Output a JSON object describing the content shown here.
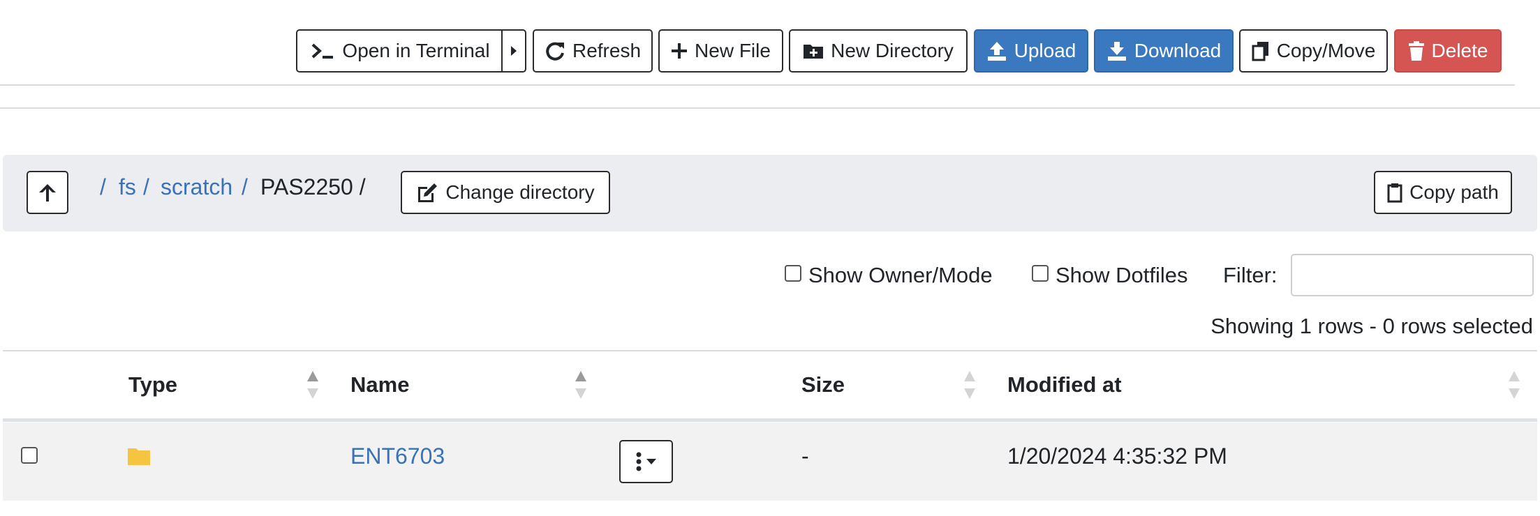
{
  "toolbar": {
    "open_terminal_label": "Open in Terminal",
    "refresh_label": "Refresh",
    "new_file_label": "New File",
    "new_directory_label": "New Directory",
    "upload_label": "Upload",
    "download_label": "Download",
    "copy_move_label": "Copy/Move",
    "delete_label": "Delete"
  },
  "path": {
    "root_sep": "/",
    "crumbs": [
      {
        "label": "fs",
        "sep": "/"
      },
      {
        "label": "scratch",
        "sep": "/"
      }
    ],
    "current": "PAS2250 /",
    "change_directory_label": "Change directory",
    "copy_path_label": "Copy path"
  },
  "filters": {
    "show_owner_mode_label": "Show Owner/Mode",
    "show_dotfiles_label": "Show Dotfiles",
    "filter_label": "Filter:",
    "filter_value": "",
    "status": "Showing 1 rows - 0 rows selected"
  },
  "table": {
    "headers": [
      "Type",
      "Name",
      "Size",
      "Modified at"
    ],
    "rows": [
      {
        "type_icon": "folder-icon",
        "name": "ENT6703",
        "size": "-",
        "modified": "1/20/2024 4:35:32 PM"
      }
    ]
  },
  "colors": {
    "primary": "#3a78bf",
    "danger": "#d55552",
    "link": "#3a72b8",
    "folder": "#f5c542"
  }
}
